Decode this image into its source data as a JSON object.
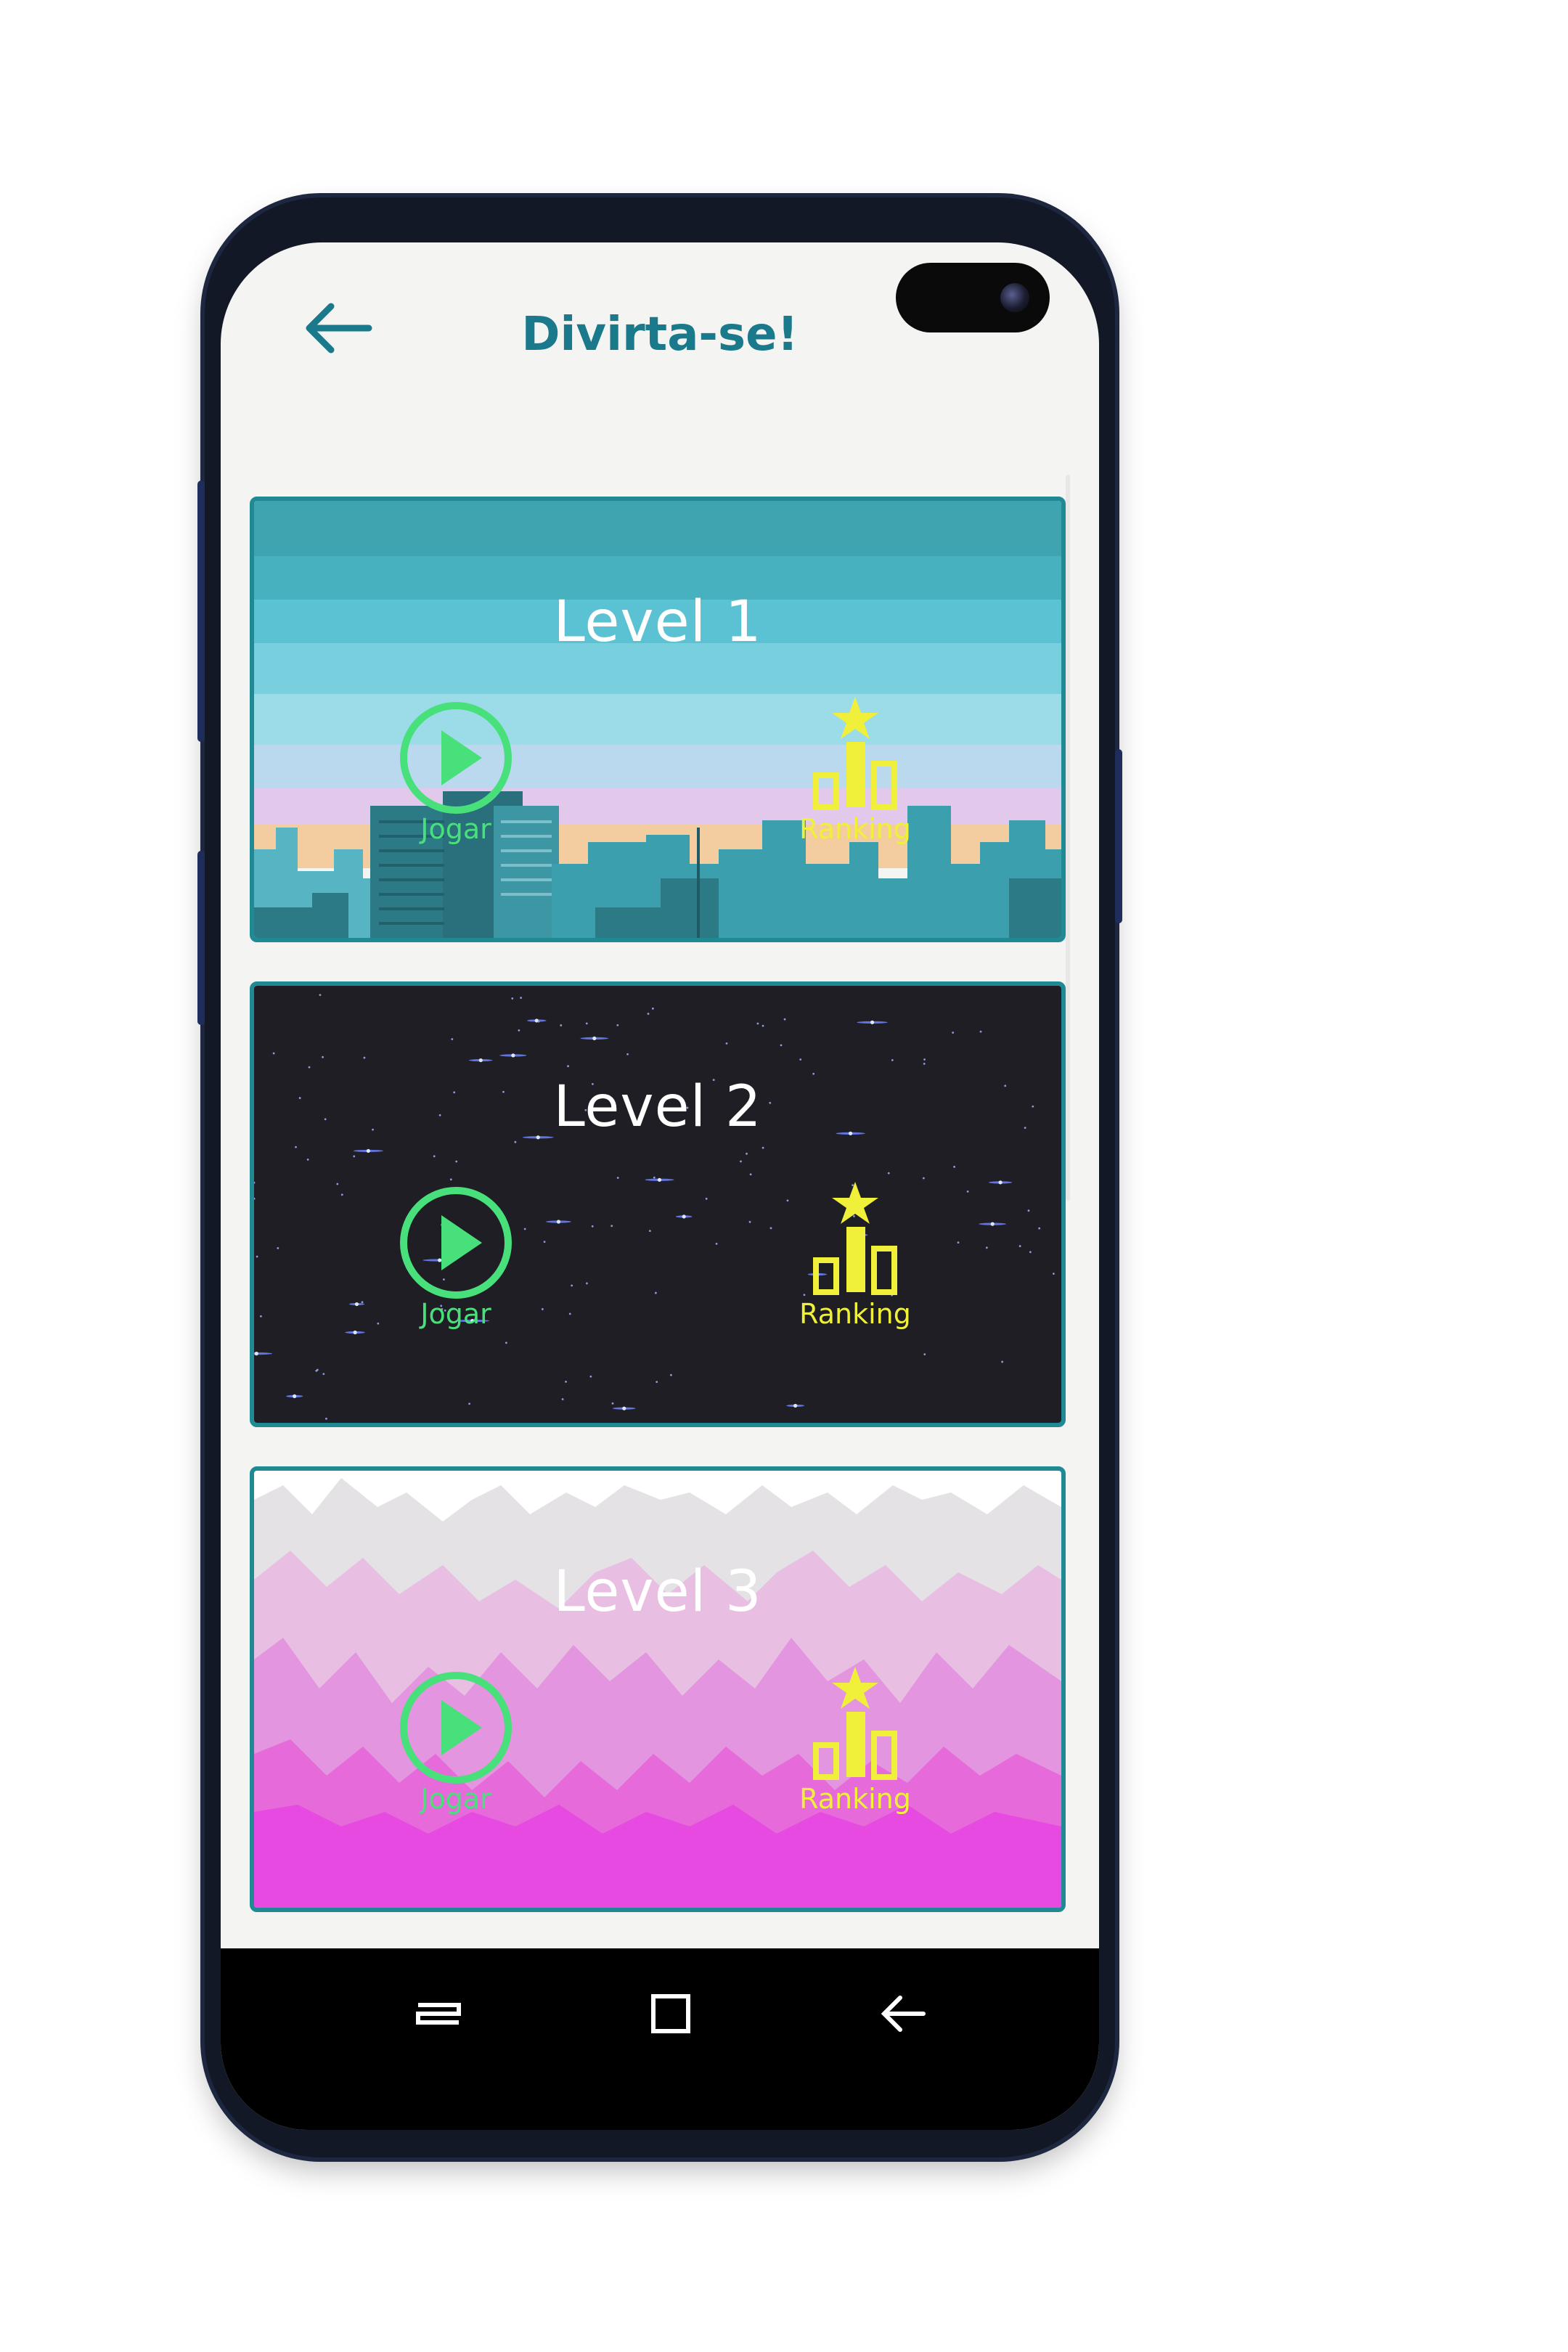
{
  "app_bar": {
    "title": "Divirta-se!",
    "back_icon": "arrow-left-icon"
  },
  "levels": [
    {
      "title": "Level 1",
      "play_label": "Jogar",
      "ranking_label": "Ranking",
      "theme": "city-skyline"
    },
    {
      "title": "Level 2",
      "play_label": "Jogar",
      "ranking_label": "Ranking",
      "theme": "starfield"
    },
    {
      "title": "Level 3",
      "play_label": "Jogar",
      "ranking_label": "Ranking",
      "theme": "pink-mountains"
    }
  ],
  "nav_bar": {
    "icons": [
      "recent-apps-icon",
      "home-icon",
      "back-icon"
    ]
  },
  "colors": {
    "accent": "#1a7a8c",
    "card_border": "#1f8a94",
    "play_green": "#48e07a",
    "ranking_yellow": "#f0f03a"
  }
}
